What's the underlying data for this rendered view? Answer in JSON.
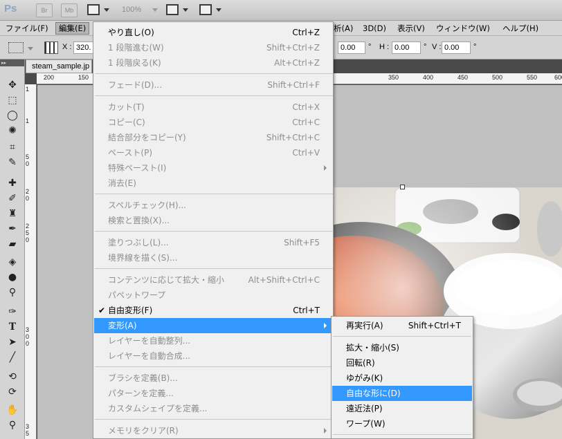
{
  "app": {
    "logo": "Ps",
    "bridge_label": "Br",
    "minibridge_label": "Mb",
    "zoom": "100%"
  },
  "menubar": {
    "file": "ファイル(F)",
    "edit": "編集(E)",
    "analysis": "析(A)",
    "3d": "3D(D)",
    "view": "表示(V)",
    "window": "ウィンドウ(W)",
    "help": "ヘルプ(H)"
  },
  "options": {
    "x_label": "X :",
    "x_value": "320.",
    "angle_value": "0.00",
    "degree": "°",
    "h_label": "H :",
    "h_value": "0.00",
    "v_label": "V :",
    "v_value": "0.00"
  },
  "document": {
    "tab": "steam_sample.jp"
  },
  "ruler_top": [
    "200",
    "150",
    "350",
    "400",
    "450",
    "500",
    "550",
    "600"
  ],
  "ruler_left": [
    "1",
    "1",
    "5",
    "0",
    "2",
    "0",
    "2",
    "5",
    "0",
    "3",
    "0",
    "0",
    "3",
    "5"
  ],
  "edit_menu": {
    "undo": {
      "label": "やり直し(O)",
      "shortcut": "Ctrl+Z"
    },
    "step_forward": {
      "label": "1 段階進む(W)",
      "shortcut": "Shift+Ctrl+Z"
    },
    "step_backward": {
      "label": "1 段階戻る(K)",
      "shortcut": "Alt+Ctrl+Z"
    },
    "fade": {
      "label": "フェード(D)...",
      "shortcut": "Shift+Ctrl+F"
    },
    "cut": {
      "label": "カット(T)",
      "shortcut": "Ctrl+X"
    },
    "copy": {
      "label": "コピー(C)",
      "shortcut": "Ctrl+C"
    },
    "copy_merged": {
      "label": "結合部分をコピー(Y)",
      "shortcut": "Shift+Ctrl+C"
    },
    "paste": {
      "label": "ペースト(P)",
      "shortcut": "Ctrl+V"
    },
    "paste_special": {
      "label": "特殊ペースト(I)"
    },
    "clear": {
      "label": "消去(E)"
    },
    "spell_check": {
      "label": "スペルチェック(H)..."
    },
    "find_replace": {
      "label": "検索と置換(X)..."
    },
    "fill": {
      "label": "塗りつぶし(L)...",
      "shortcut": "Shift+F5"
    },
    "stroke": {
      "label": "境界線を描く(S)..."
    },
    "content_aware_scale": {
      "label": "コンテンツに応じて拡大・縮小",
      "shortcut": "Alt+Shift+Ctrl+C"
    },
    "puppet_warp": {
      "label": "パペットワープ"
    },
    "free_transform": {
      "label": "自由変形(F)",
      "shortcut": "Ctrl+T",
      "check": "✔"
    },
    "transform": {
      "label": "変形(A)"
    },
    "auto_align": {
      "label": "レイヤーを自動整列..."
    },
    "auto_blend": {
      "label": "レイヤーを自動合成..."
    },
    "define_brush": {
      "label": "ブラシを定義(B)..."
    },
    "define_pattern": {
      "label": "パターンを定義..."
    },
    "define_shape": {
      "label": "カスタムシェイプを定義..."
    },
    "purge": {
      "label": "メモリをクリア(R)"
    }
  },
  "transform_menu": {
    "again": {
      "label": "再実行(A)",
      "shortcut": "Shift+Ctrl+T"
    },
    "scale": {
      "label": "拡大・縮小(S)"
    },
    "rotate": {
      "label": "回転(R)"
    },
    "skew": {
      "label": "ゆがみ(K)"
    },
    "distort": {
      "label": "自由な形に(D)"
    },
    "perspective": {
      "label": "遠近法(P)"
    },
    "warp": {
      "label": "ワープ(W)"
    }
  },
  "colors": {
    "highlight": "#3399ff",
    "menu_bg": "#f0f0f0",
    "disabled_text": "#8e8e8e"
  }
}
